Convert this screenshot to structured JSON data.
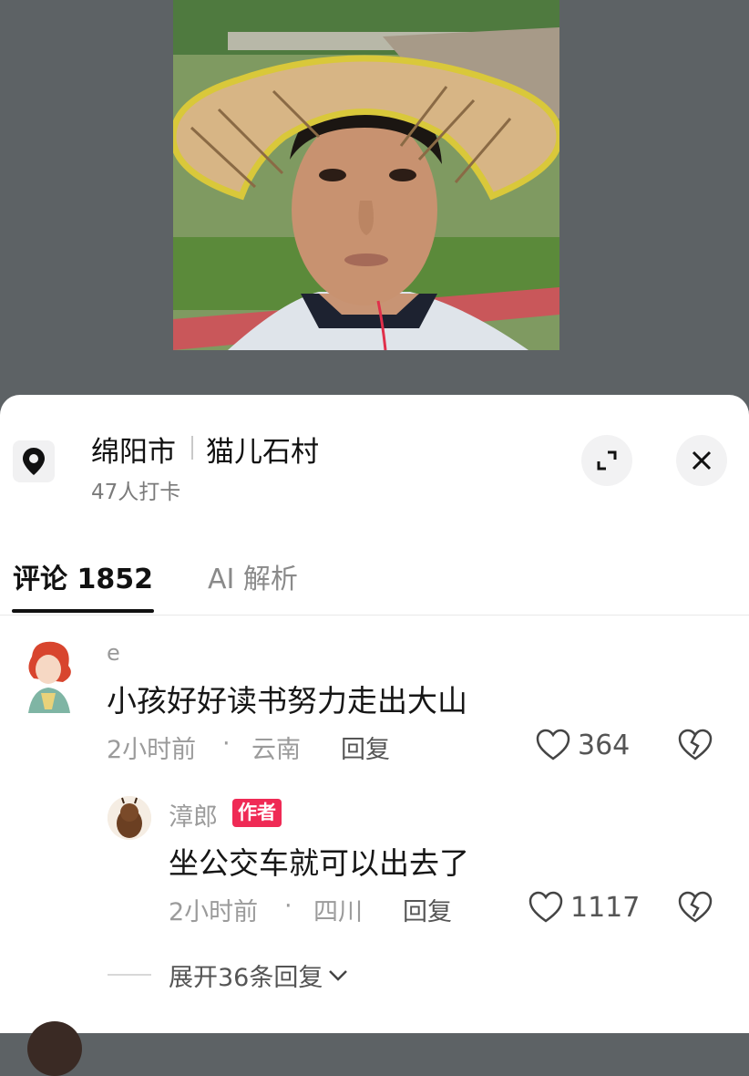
{
  "location": {
    "city": "绵阳市",
    "village": "猫儿石村",
    "checkin": "47人打卡",
    "pin_icon": "location-pin-icon"
  },
  "header_buttons": {
    "expand_icon": "expand-icon",
    "close_icon": "close-icon"
  },
  "tabs": {
    "comments_label": "评论 1852",
    "ai_label": "AI 解析",
    "active": "comments"
  },
  "comments": [
    {
      "username": "e",
      "text": "小孩好好读书努力走出大山",
      "time": "2小时前",
      "dot": "·",
      "region": "云南",
      "reply_label": "回复",
      "likes": "364",
      "replies": [
        {
          "username": "漳郎",
          "badge": "作者",
          "text": "坐公交车就可以出去了",
          "time": "2小时前",
          "dot": "·",
          "region": "四川",
          "reply_label": "回复",
          "likes": "1117"
        }
      ],
      "expand_replies": "展开36条回复"
    }
  ],
  "colors": {
    "badge": "#ef2a55",
    "background_dim": "#5d6265"
  }
}
